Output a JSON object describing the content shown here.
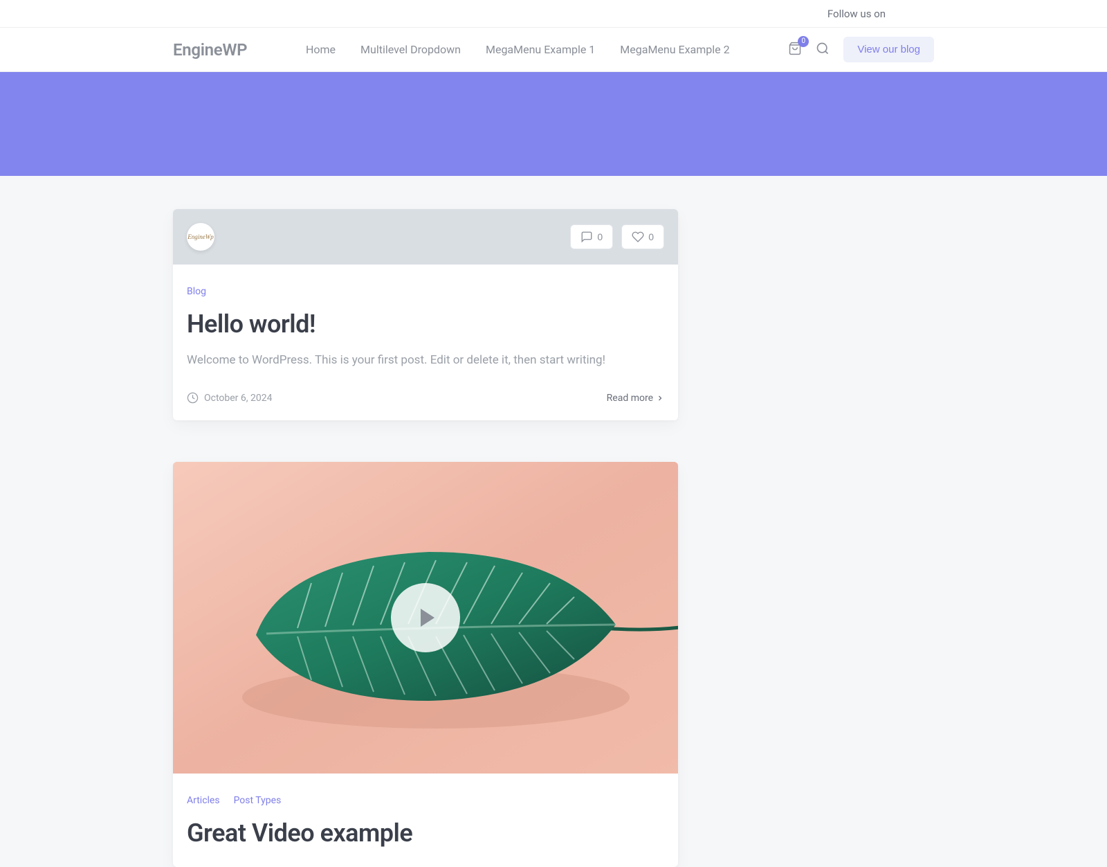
{
  "topbar": {
    "follow_text": "Follow us on"
  },
  "header": {
    "logo": "EngineWP",
    "nav": [
      "Home",
      "Multilevel Dropdown",
      "MegaMenu Example 1",
      "MegaMenu Example 2"
    ],
    "cart_count": "0",
    "blog_button": "View our blog"
  },
  "posts": [
    {
      "avatar_text": "EngineWp",
      "comments_count": "0",
      "likes_count": "0",
      "categories": [
        "Blog"
      ],
      "title": "Hello world!",
      "excerpt": "Welcome to WordPress. This is your first post. Edit or delete it, then start writing!",
      "date": "October 6, 2024",
      "read_more": "Read more"
    },
    {
      "categories": [
        "Articles",
        "Post Types"
      ],
      "title": "Great Video example"
    }
  ]
}
